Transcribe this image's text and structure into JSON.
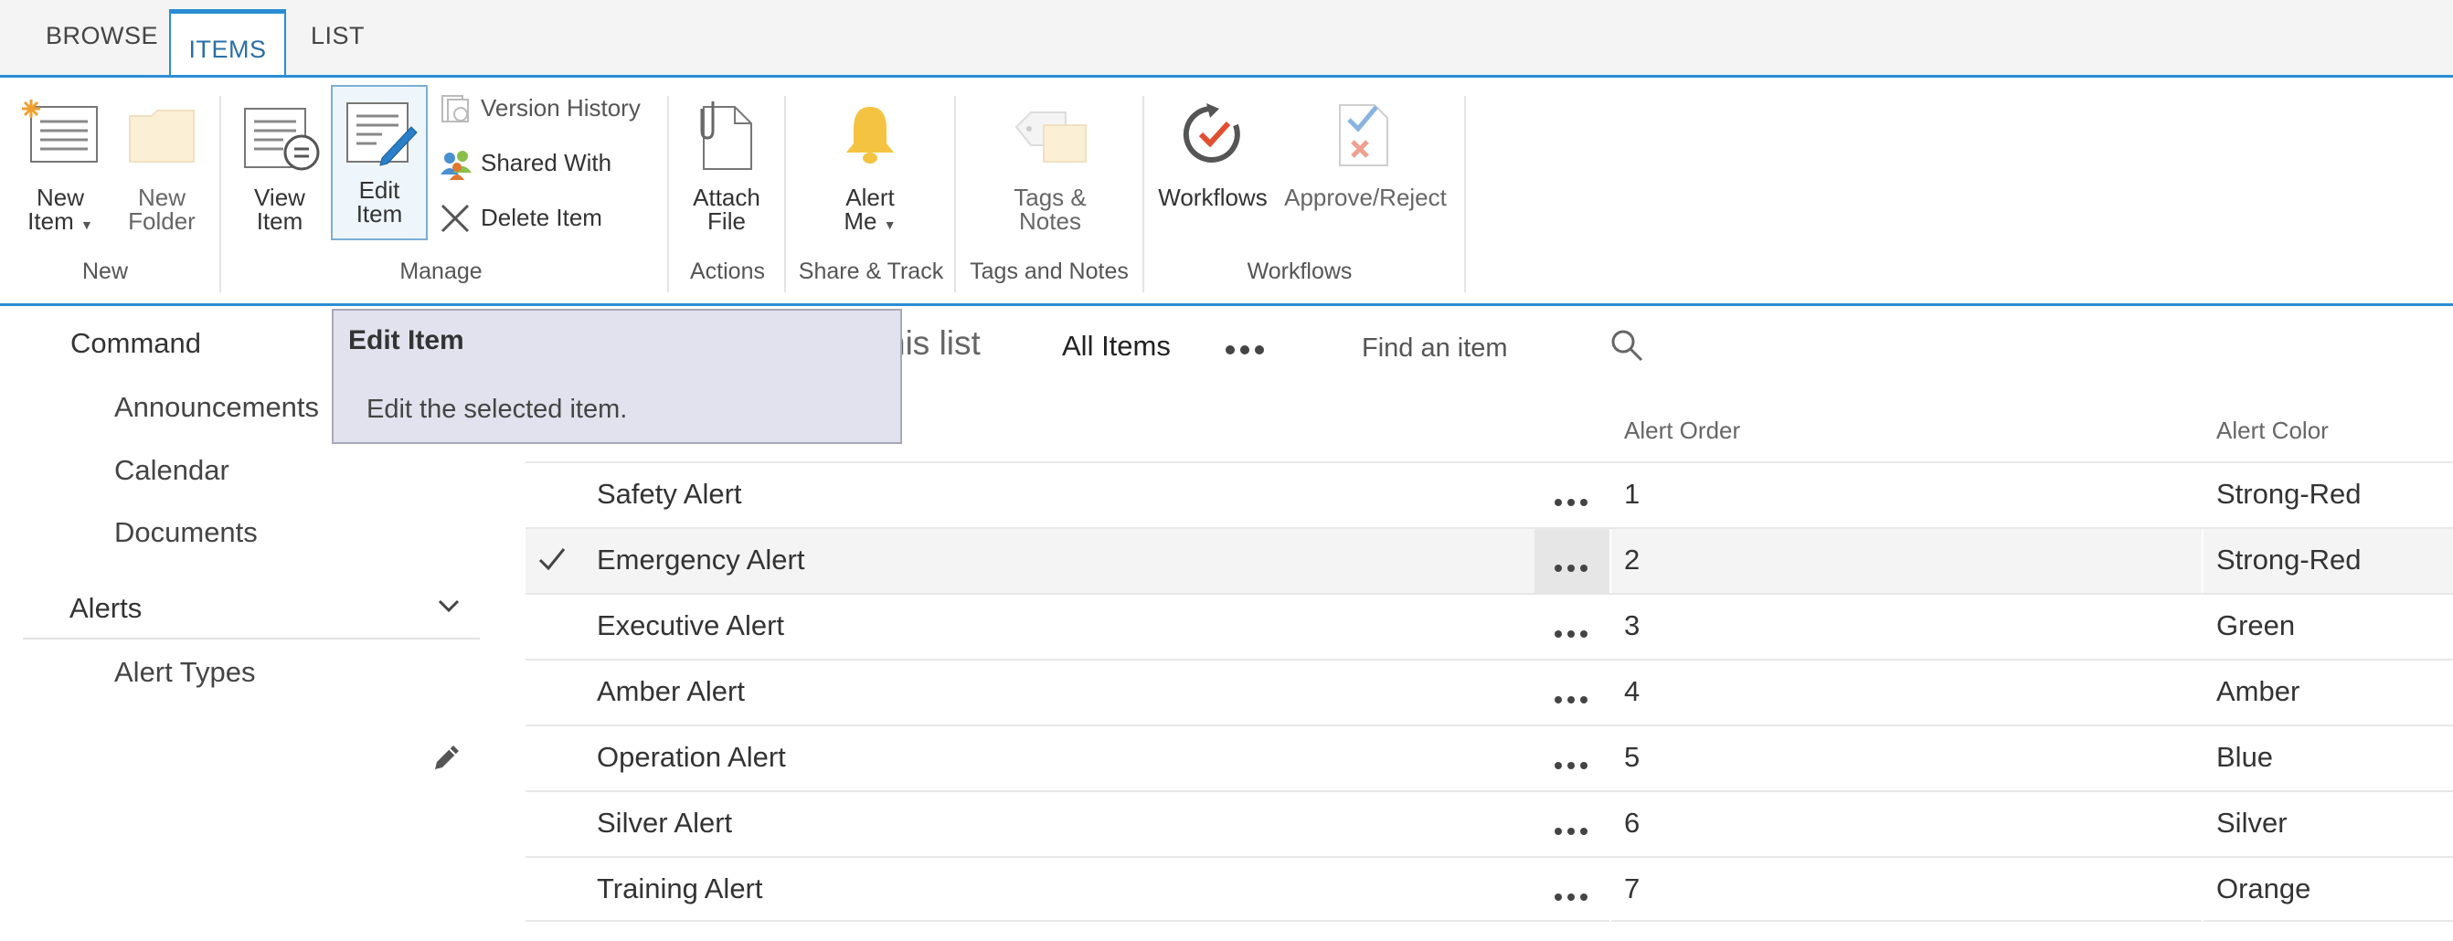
{
  "ribbon_tabs": {
    "browse": "BROWSE",
    "items": "ITEMS",
    "list": "LIST"
  },
  "ribbon": {
    "new_item": [
      "New",
      "Item"
    ],
    "new_folder": [
      "New",
      "Folder"
    ],
    "view_item": [
      "View",
      "Item"
    ],
    "edit_item": [
      "Edit",
      "Item"
    ],
    "version_history": "Version History",
    "shared_with": "Shared With",
    "delete_item": "Delete Item",
    "attach_file": [
      "Attach",
      "File"
    ],
    "alert_me": [
      "Alert",
      "Me"
    ],
    "tags_notes": [
      "Tags &",
      "Notes"
    ],
    "workflows": "Workflows",
    "approve_reject": "Approve/Reject",
    "groups": {
      "new": "New",
      "manage": "Manage",
      "actions": "Actions",
      "share_track": "Share & Track",
      "tags_and_notes": "Tags and Notes",
      "workflows": "Workflows"
    }
  },
  "tooltip": {
    "title": "Edit Item",
    "body": "Edit the selected item."
  },
  "nav": {
    "site_title": "Command",
    "items": [
      "Announcements",
      "Calendar",
      "Documents"
    ],
    "alerts_heading": "Alerts",
    "alert_types": "Alert Types"
  },
  "list_header": {
    "partial_text": "nis list",
    "view_name": "All Items",
    "search_placeholder": "Find an item"
  },
  "columns": {
    "alert_order": "Alert Order",
    "alert_color": "Alert Color"
  },
  "rows": [
    {
      "title": "Safety Alert",
      "order": "1",
      "color": "Strong-Red"
    },
    {
      "title": "Emergency Alert",
      "order": "2",
      "color": "Strong-Red"
    },
    {
      "title": "Executive Alert",
      "order": "3",
      "color": "Green"
    },
    {
      "title": "Amber Alert",
      "order": "4",
      "color": "Amber"
    },
    {
      "title": "Operation Alert",
      "order": "5",
      "color": "Blue"
    },
    {
      "title": "Silver Alert",
      "order": "6",
      "color": "Silver"
    },
    {
      "title": "Training Alert",
      "order": "7",
      "color": "Orange"
    }
  ],
  "selected_row_index": 1,
  "colors": {
    "accent": "#2a8dd4",
    "tooltip_bg": "#e2e2ee",
    "selected_row": "#f4f4f4"
  }
}
